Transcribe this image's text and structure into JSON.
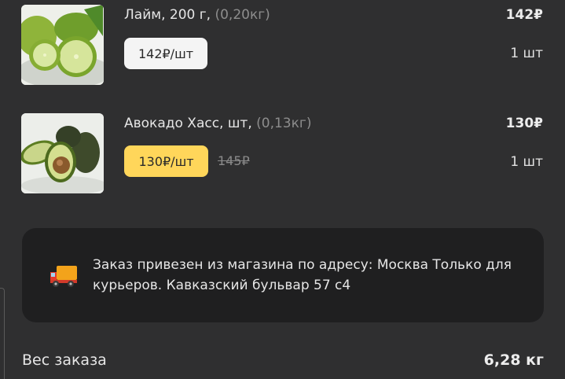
{
  "items": [
    {
      "name": "Лайм, 200 г,",
      "weight": "(0,20кг)",
      "unit_price": "142₽/шт",
      "old_price": "",
      "total": "142₽",
      "quantity": "1 шт",
      "tag_color": "#f4f4f4"
    },
    {
      "name": "Авокадо Хасс, шт,",
      "weight": "(0,13кг)",
      "unit_price": "130₽/шт",
      "old_price": "145₽",
      "total": "130₽",
      "quantity": "1 шт",
      "tag_color": "#ffd65a"
    }
  ],
  "notice": {
    "icon": "delivery-truck-icon",
    "text": "Заказ привезен из магазина по адресу: Москва Только для курьеров. Кавказский бульвар 57 с4"
  },
  "order_weight": {
    "label": "Вес заказа",
    "value": "6,28 кг"
  }
}
